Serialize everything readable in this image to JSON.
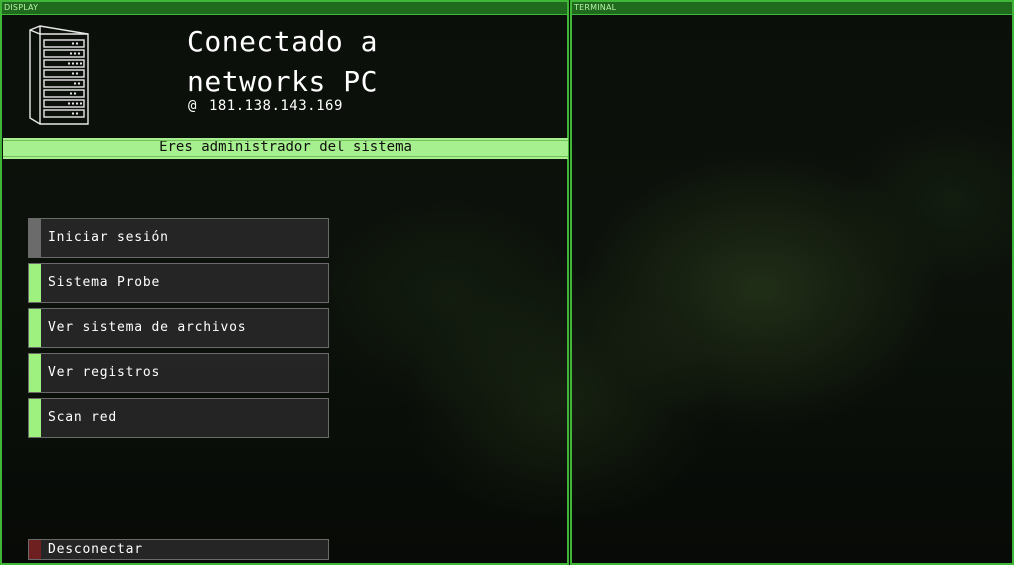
{
  "display_panel": {
    "header": "DISPLAY",
    "title_line1": "Conectado a",
    "title_line2": "networks PC",
    "ip_prefix": "@",
    "ip_address": "181.138.143.169",
    "admin_banner": "Eres administrador del sistema",
    "server_icon": "server-rack-icon",
    "menu": [
      {
        "label": "Iniciar sesión",
        "accent": "#6b6b6b"
      },
      {
        "label": "Sistema Probe",
        "accent": "#9ef07f"
      },
      {
        "label": "Ver sistema de archivos",
        "accent": "#9ef07f"
      },
      {
        "label": "Ver registros",
        "accent": "#9ef07f"
      },
      {
        "label": "Scan red",
        "accent": "#9ef07f"
      }
    ],
    "disconnect_label": "Desconectar",
    "disconnect_accent": "#6e1f1f"
  },
  "terminal_panel": {
    "header": "TERMINAL"
  },
  "colors": {
    "panel_border": "#3fb638",
    "header_bg": "#1f6a1c",
    "banner_bg": "#a7f08f"
  }
}
